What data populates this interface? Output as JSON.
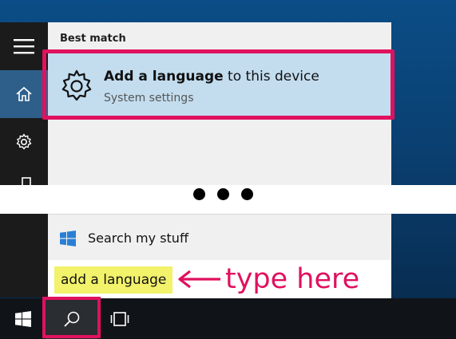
{
  "search_panel": {
    "section_label": "Best match",
    "best_match": {
      "title_bold": "Add a language",
      "title_rest": " to this device",
      "subtitle": "System settings",
      "icon": "gear-icon"
    },
    "search_my_stuff": {
      "label": "Search my stuff",
      "icon": "windows-logo-icon"
    }
  },
  "search_box": {
    "value": "add a language"
  },
  "annotation": {
    "text": "type here",
    "color": "#e0115f"
  },
  "sidebar": {
    "items": [
      {
        "icon": "hamburger-menu-icon"
      },
      {
        "icon": "home-icon",
        "active": true
      },
      {
        "icon": "gear-icon"
      },
      {
        "icon": "feedback-icon"
      }
    ]
  },
  "taskbar": {
    "items": [
      {
        "icon": "windows-start-icon"
      },
      {
        "icon": "search-icon"
      },
      {
        "icon": "task-view-icon"
      }
    ]
  },
  "colors": {
    "accent": "#2e5f8a",
    "result_highlight": "#c3ddef",
    "annotation": "#e0115f",
    "search_highlight": "#f2f26b"
  }
}
